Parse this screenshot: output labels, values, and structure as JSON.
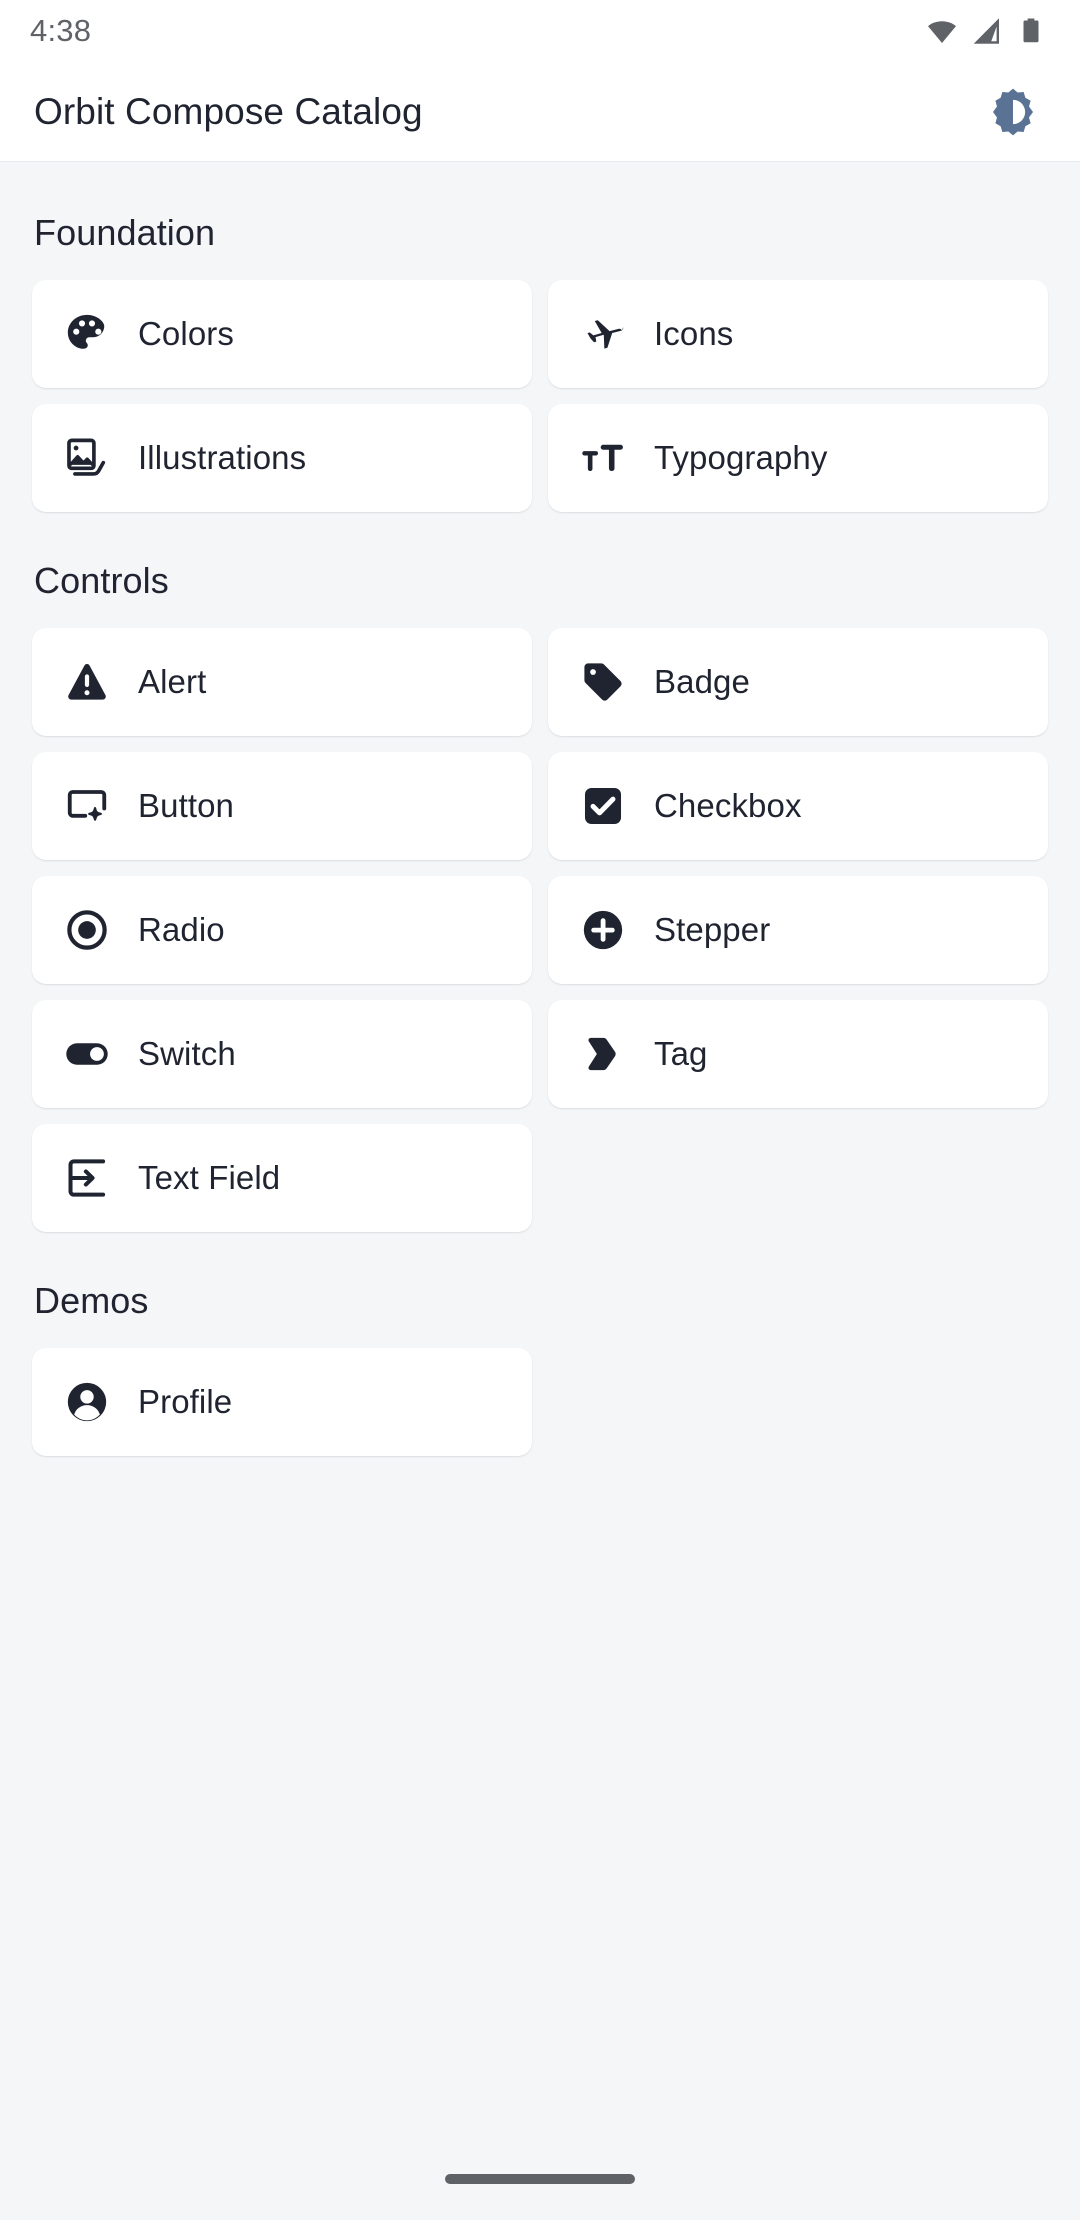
{
  "status_bar": {
    "time": "4:38",
    "icons": [
      "wifi-icon",
      "cell-signal-icon",
      "battery-icon"
    ]
  },
  "app_bar": {
    "title": "Orbit Compose Catalog",
    "action_icon": "brightness-theme-toggle-icon",
    "action_icon_color": "#5a7294"
  },
  "theme": {
    "background": "#f4f6f8",
    "surface": "#ffffff",
    "on_surface": "#1f2430",
    "accent": "#5a7294"
  },
  "sections": [
    {
      "title": "Foundation",
      "items": [
        {
          "label": "Colors",
          "icon": "palette-icon"
        },
        {
          "label": "Icons",
          "icon": "airplane-icon"
        },
        {
          "label": "Illustrations",
          "icon": "photo-stack-icon"
        },
        {
          "label": "Typography",
          "icon": "text-size-icon"
        }
      ]
    },
    {
      "title": "Controls",
      "items": [
        {
          "label": "Alert",
          "icon": "warning-triangle-icon"
        },
        {
          "label": "Badge",
          "icon": "tag-filled-icon"
        },
        {
          "label": "Button",
          "icon": "button-sparkle-icon"
        },
        {
          "label": "Checkbox",
          "icon": "checkbox-checked-icon"
        },
        {
          "label": "Radio",
          "icon": "radio-selected-icon"
        },
        {
          "label": "Stepper",
          "icon": "plus-circle-icon"
        },
        {
          "label": "Switch",
          "icon": "switch-on-icon"
        },
        {
          "label": "Tag",
          "icon": "chevron-tag-icon"
        },
        {
          "label": "Text Field",
          "icon": "input-arrow-icon"
        }
      ]
    },
    {
      "title": "Demos",
      "items": [
        {
          "label": "Profile",
          "icon": "person-avatar-icon"
        }
      ]
    }
  ],
  "nav_bar": {
    "home_indicator": "home-indicator-pill"
  }
}
